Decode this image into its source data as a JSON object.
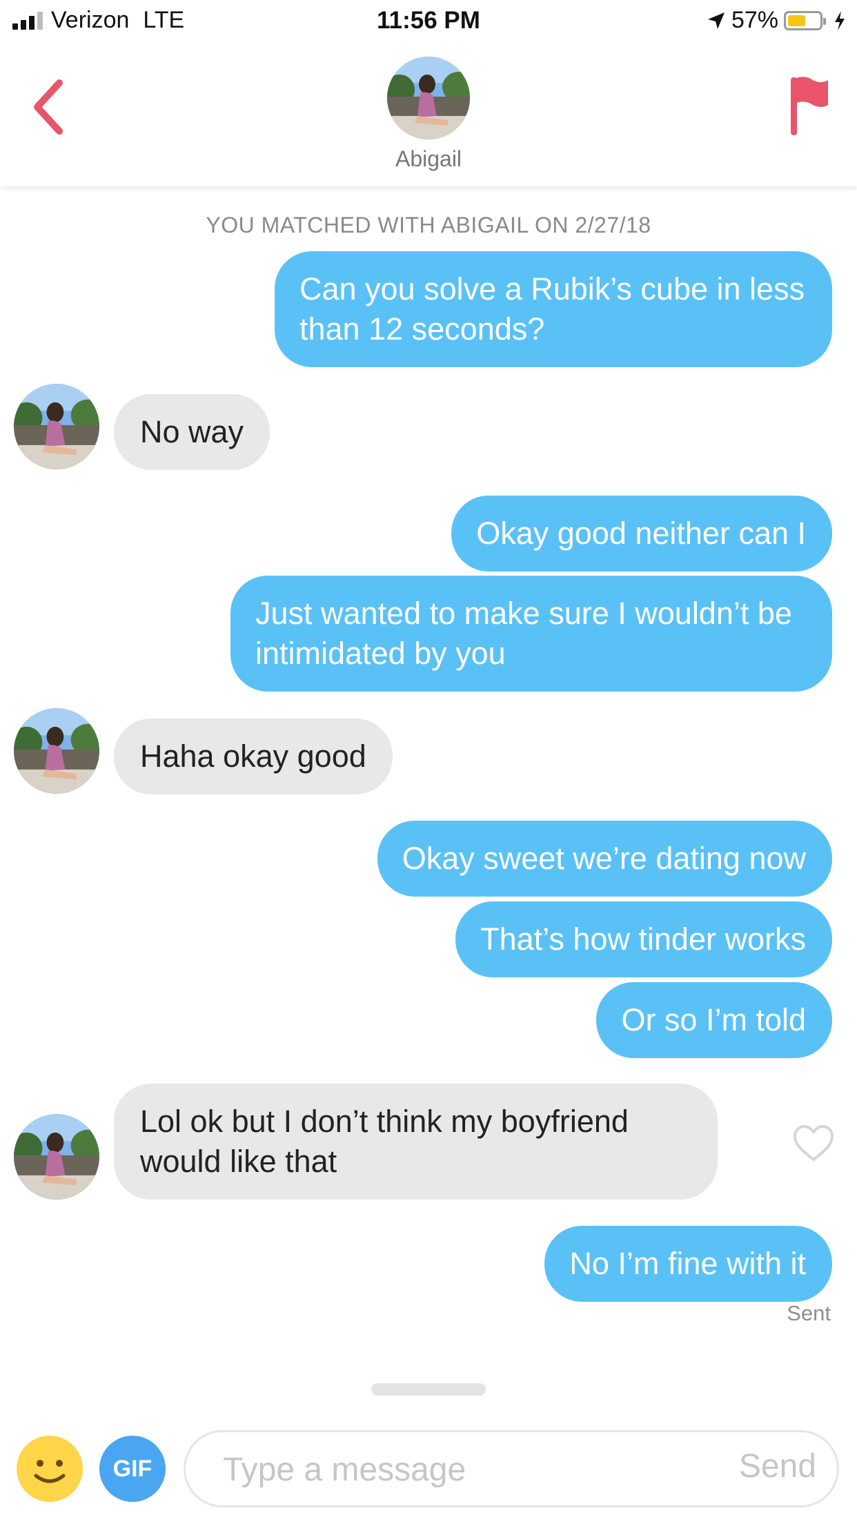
{
  "status_bar": {
    "carrier": "Verizon",
    "network": "LTE",
    "time": "11:56 PM",
    "battery": "57%",
    "battery_level": 0.57
  },
  "header": {
    "name": "Abigail"
  },
  "match_banner": "YOU MATCHED WITH ABIGAIL ON 2/27/18",
  "messages": [
    {
      "from": "me",
      "text": "Can you solve a Rubik’s cube in less than 12 seconds?"
    },
    {
      "from": "them",
      "text": "No way"
    },
    {
      "from": "me",
      "text": "Okay good neither can I"
    },
    {
      "from": "me",
      "text": "Just wanted to make sure I wouldn’t be intimidated by you"
    },
    {
      "from": "them",
      "text": "Haha okay good"
    },
    {
      "from": "me",
      "text": "Okay sweet we’re dating now"
    },
    {
      "from": "me",
      "text": "That’s how tinder works"
    },
    {
      "from": "me",
      "text": "Or so I’m told"
    },
    {
      "from": "them",
      "text": "Lol ok but I don’t think my boyfriend would like that"
    },
    {
      "from": "me",
      "text": "No I’m fine with it"
    }
  ],
  "sent_label": "Sent",
  "composer": {
    "gif_label": "GIF",
    "placeholder": "Type a message",
    "send_label": "Send"
  },
  "colors": {
    "outgoing": "#5ac1f6",
    "incoming": "#e8e8e8",
    "accent": "#e8556a"
  },
  "icons": [
    "back-chevron-icon",
    "report-flag-icon",
    "heart-icon",
    "emoji-icon"
  ]
}
